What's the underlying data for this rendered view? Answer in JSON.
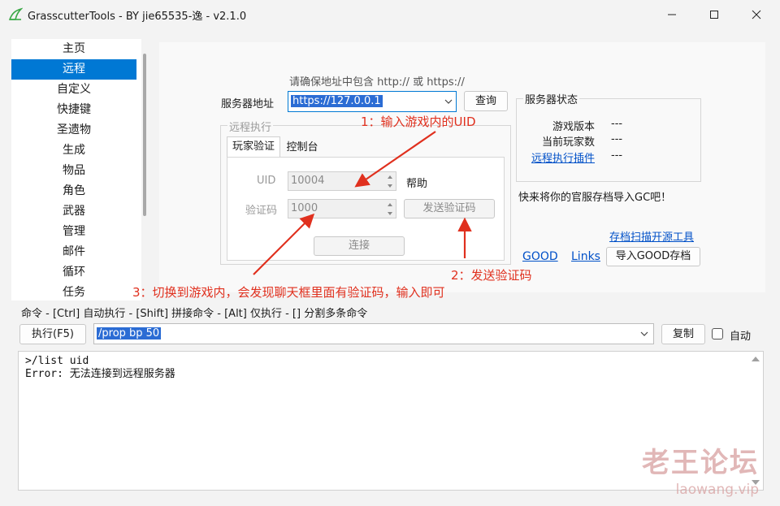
{
  "window": {
    "title": "GrasscutterTools  - BY jie65535-逸  - v2.1.0",
    "app_icon": "grass-icon",
    "controls": [
      "minimize-icon",
      "maximize-icon",
      "close-icon"
    ]
  },
  "nav": {
    "items": [
      "主页",
      "远程",
      "自定义",
      "快捷键",
      "圣遗物",
      "生成",
      "物品",
      "角色",
      "武器",
      "管理",
      "邮件",
      "循环",
      "任务"
    ],
    "selected": "远程"
  },
  "remote": {
    "hint": "请确保地址中包含 http:// 或 https://",
    "server_label": "服务器地址",
    "server_value": "https://127.0.0.1",
    "query_button": "查询",
    "group_title": "远程执行",
    "tabs": [
      "玩家验证",
      "控制台"
    ],
    "active_tab": "玩家验证",
    "uid_label": "UID",
    "uid_value": "10004",
    "help_label": "帮助",
    "code_label": "验证码",
    "code_value": "1000",
    "send_code_button": "发送验证码",
    "connect_button": "连接"
  },
  "server_status": {
    "title": "服务器状态",
    "rows": [
      {
        "label": "游戏版本",
        "value": "---"
      },
      {
        "label": "当前玩家数",
        "value": "---"
      },
      {
        "label": "远程执行插件",
        "value": "---",
        "link": true
      }
    ]
  },
  "gc_import": {
    "text": "快来将你的官服存档导入GC吧！",
    "scan_link": "存档扫描开源工具",
    "good_link": "GOOD",
    "links_link": "Links",
    "import_button": "导入GOOD存档"
  },
  "annotations": {
    "step1": "1：输入游戏内的UID",
    "step2": "2：发送验证码",
    "step3": "3：切换到游戏内，会发现聊天框里面有验证码，输入即可",
    "color": "#e0301e"
  },
  "command": {
    "hint": "命令  - [Ctrl] 自动执行  - [Shift] 拼接命令  - [Alt] 仅执行  - [] 分割多条命令",
    "run_button": "执行(F5)",
    "input_value": "/prop bp 50",
    "copy_button": "复制",
    "auto_label": "自动",
    "auto_checked": false
  },
  "console": {
    "lines": [
      ">/list uid",
      "Error: 无法连接到远程服务器"
    ]
  },
  "watermark": {
    "line1": "老王论坛",
    "line2": "laowang.vip"
  },
  "colors": {
    "accent": "#0078d4",
    "selection": "#2b6cd4",
    "link": "#0050c8"
  }
}
